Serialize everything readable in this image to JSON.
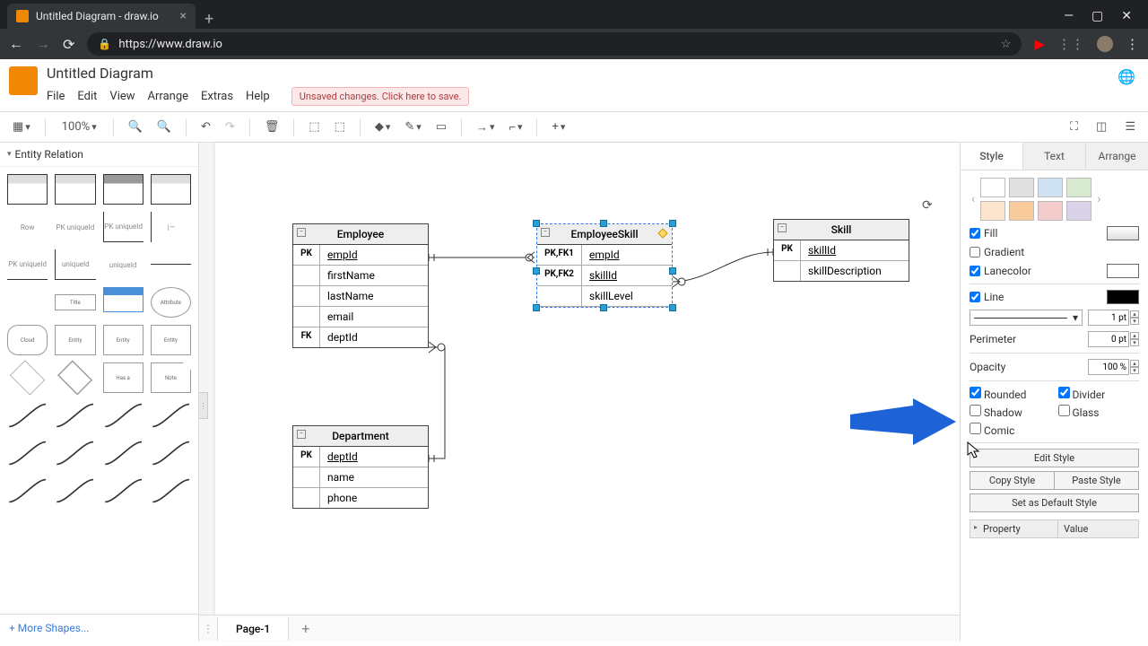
{
  "browser": {
    "tab_title": "Untitled Diagram - draw.io",
    "url": "https://www.draw.io"
  },
  "app": {
    "title": "Untitled Diagram",
    "menus": [
      "File",
      "Edit",
      "View",
      "Arrange",
      "Extras",
      "Help"
    ],
    "unsaved": "Unsaved changes. Click here to save."
  },
  "toolbar": {
    "zoom": "100%"
  },
  "sidebar": {
    "section": "Entity Relation",
    "more": "+ More Shapes...",
    "row_label": "Row"
  },
  "canvas": {
    "entities": {
      "employee": {
        "title": "Employee",
        "rows": [
          {
            "k": "PK",
            "v": "empId",
            "u": true
          },
          {
            "k": "",
            "v": "firstName"
          },
          {
            "k": "",
            "v": "lastName"
          },
          {
            "k": "",
            "v": "email"
          },
          {
            "k": "FK",
            "v": "deptId"
          }
        ]
      },
      "employeeSkill": {
        "title": "EmployeeSkill",
        "rows": [
          {
            "k": "PK,FK1",
            "v": "empId",
            "u": true
          },
          {
            "k": "PK,FK2",
            "v": "skillId",
            "u": true
          },
          {
            "k": "",
            "v": "skillLevel"
          }
        ]
      },
      "skill": {
        "title": "Skill",
        "rows": [
          {
            "k": "PK",
            "v": "skillId",
            "u": true
          },
          {
            "k": "",
            "v": "skillDescription"
          }
        ]
      },
      "department": {
        "title": "Department",
        "rows": [
          {
            "k": "PK",
            "v": "deptId",
            "u": true
          },
          {
            "k": "",
            "v": "name"
          },
          {
            "k": "",
            "v": "phone"
          }
        ]
      }
    }
  },
  "rpanel": {
    "tabs": [
      "Style",
      "Text",
      "Arrange"
    ],
    "swatches1": [
      "#ffffff",
      "#e0e0e0",
      "#cfe2f3",
      "#d9ead3"
    ],
    "swatches2": [
      "#fce5cd",
      "#f9cb9c",
      "#f4cccc",
      "#d9d2e9"
    ],
    "fill": "Fill",
    "gradient": "Gradient",
    "lanecolor": "Lanecolor",
    "line": "Line",
    "line_pt": "1 pt",
    "perimeter": "Perimeter",
    "perimeter_pt": "0 pt",
    "opacity": "Opacity",
    "opacity_val": "100 %",
    "rounded": "Rounded",
    "divider": "Divider",
    "shadow": "Shadow",
    "glass": "Glass",
    "comic": "Comic",
    "edit_style": "Edit Style",
    "copy_style": "Copy Style",
    "paste_style": "Paste Style",
    "default_style": "Set as Default Style",
    "property": "Property",
    "value": "Value"
  },
  "footer": {
    "page": "Page-1"
  }
}
